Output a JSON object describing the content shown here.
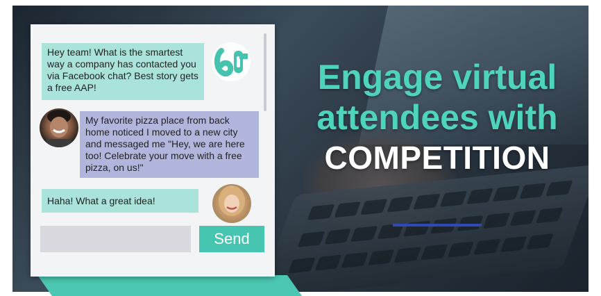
{
  "chat": {
    "messages": [
      {
        "sender": "logo",
        "text": "Hey team! What is the smartest way a company has contacted you via Facebook chat? Best story gets a free AAP!"
      },
      {
        "sender": "man",
        "text": "My favorite pizza place from back home noticed I moved to a new city and messaged me \"Hey, we are here too! Celebrate your move with a free pizza, on us!\""
      },
      {
        "sender": "woman",
        "text": "Haha! What a great idea!"
      }
    ],
    "logo_text": "60",
    "input_value": "",
    "send_label": "Send"
  },
  "headline": {
    "line1": "Engage virtual",
    "line2": "attendees with",
    "line3": "COMPETITION"
  },
  "colors": {
    "accent_teal": "#4ed3bd",
    "button_teal": "#46c6b1",
    "bubble_teal": "#aae3da",
    "bubble_purple": "#b3b6dc",
    "underline_blue": "#2f49b5"
  },
  "icons": [
    "logo-60-icon",
    "avatar-man",
    "avatar-woman"
  ]
}
